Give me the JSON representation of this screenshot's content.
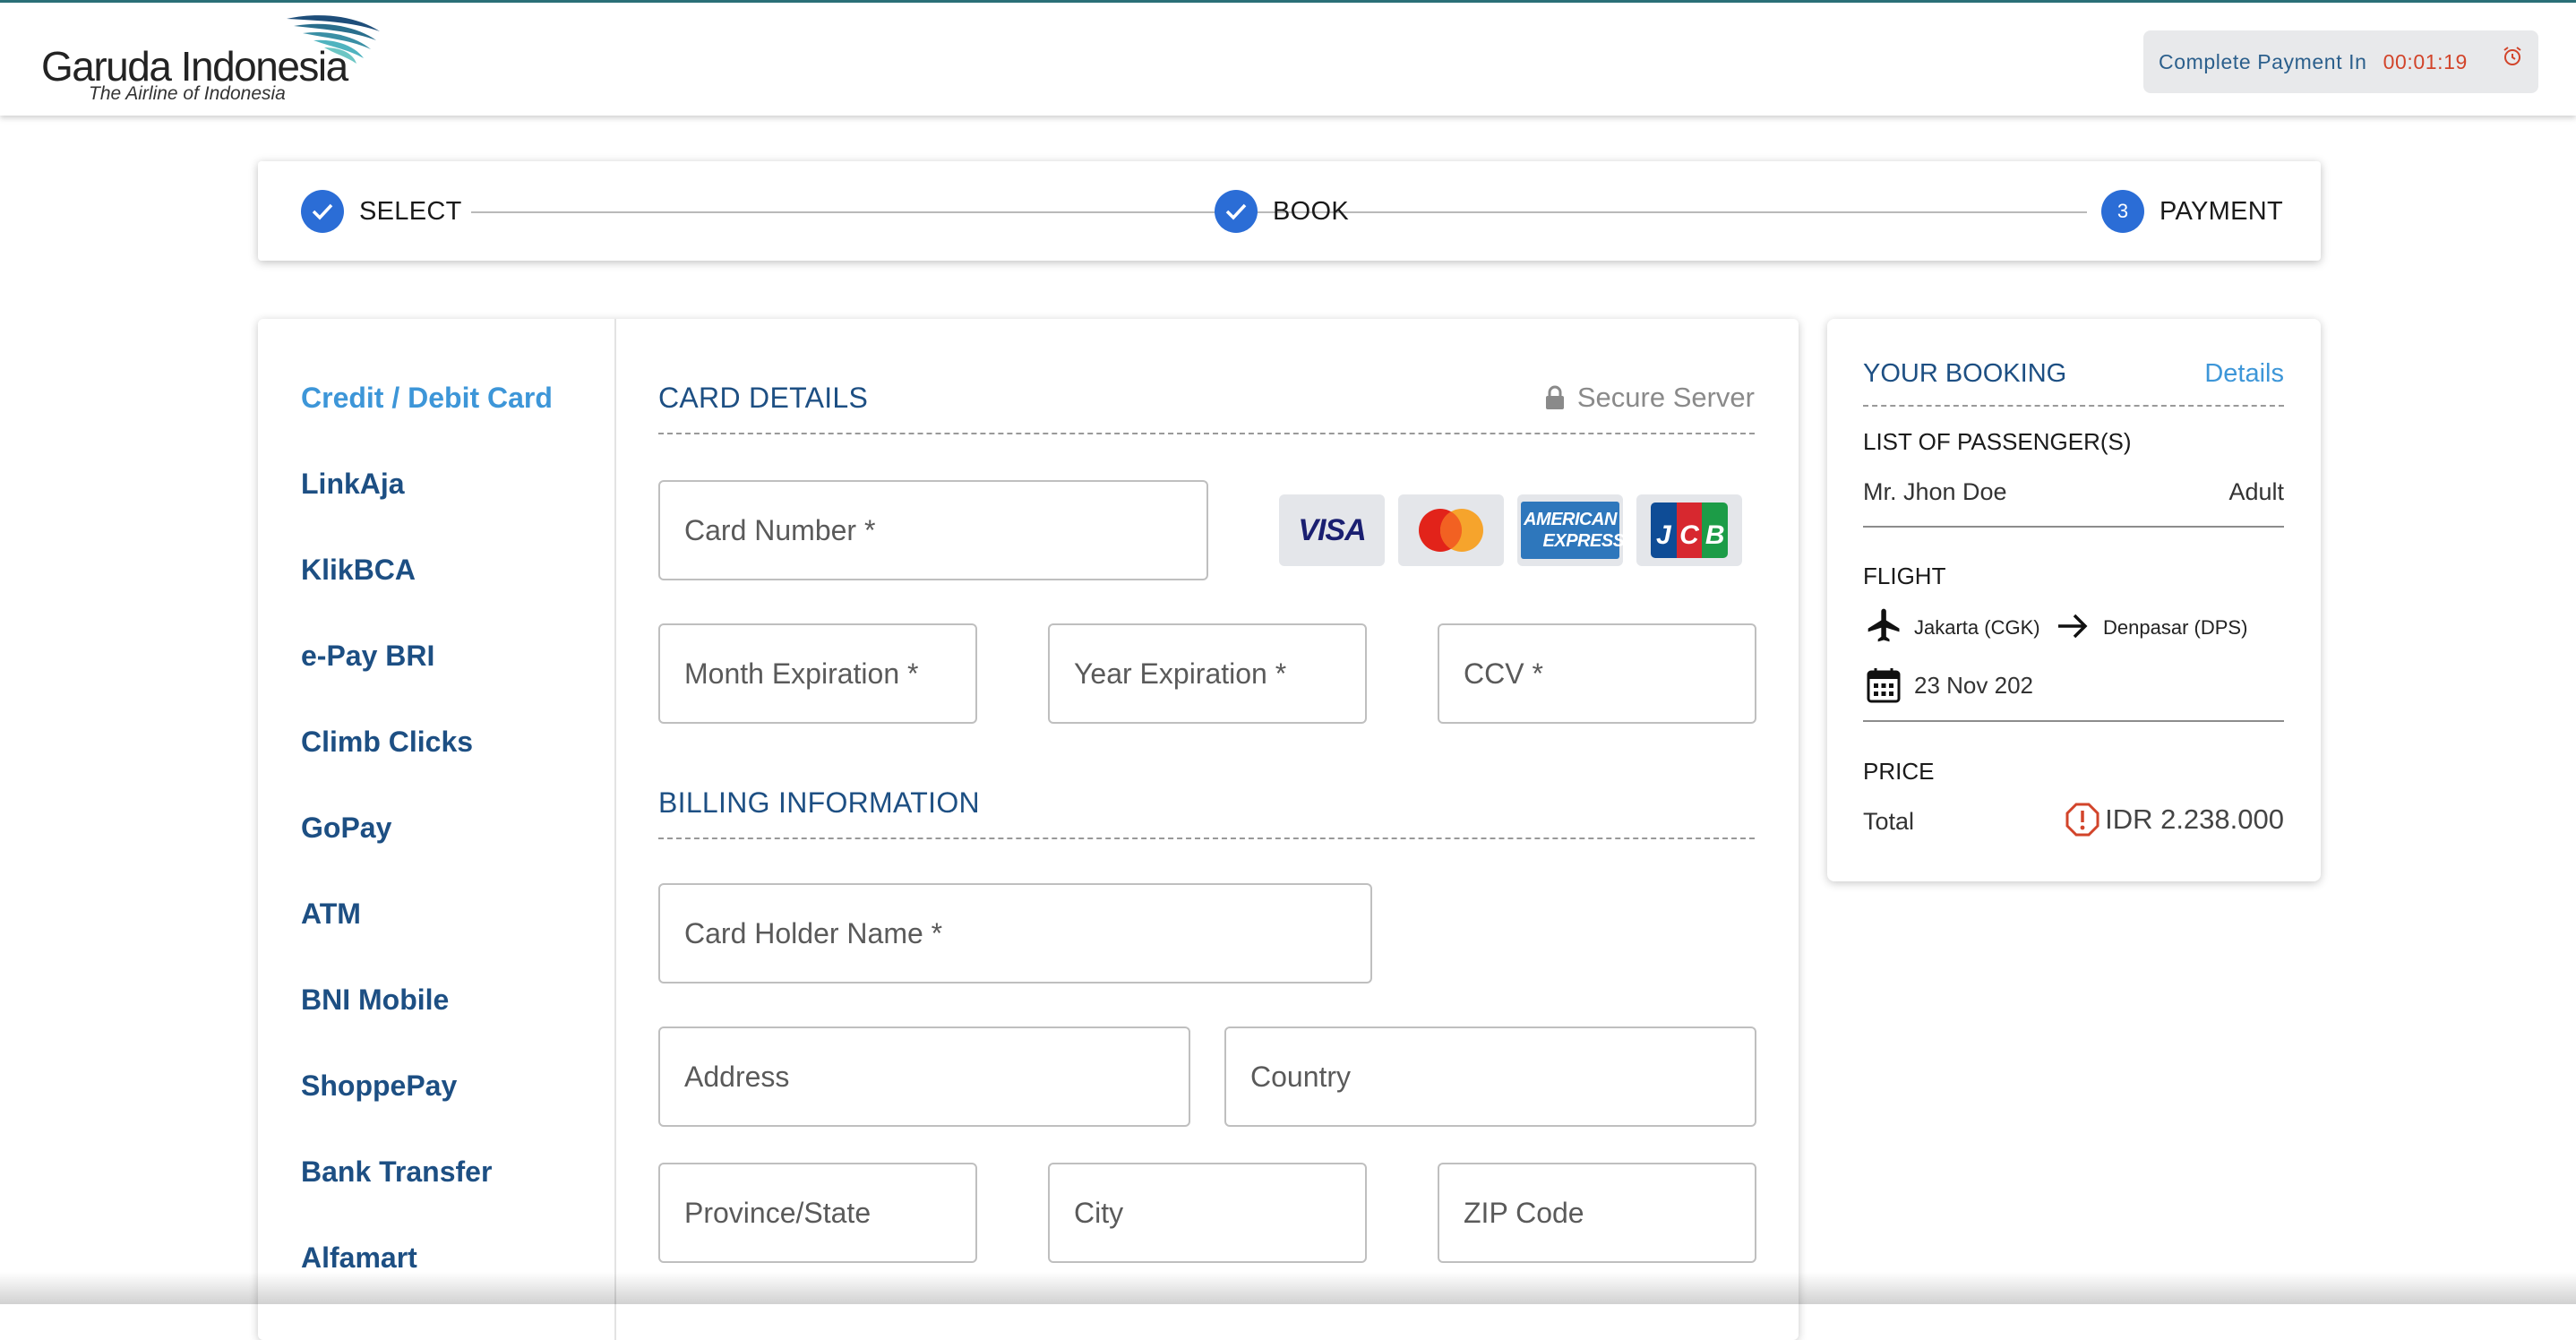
{
  "header": {
    "brand": "Garuda Indonesia",
    "tagline": "The Airline of Indonesia",
    "timer_label": "Complete Payment In",
    "timer_value": "00:01:19",
    "timer_icon": "alarm-clock-icon"
  },
  "stepper": {
    "steps": [
      {
        "label": "SELECT",
        "state": "done",
        "marker": "check-icon"
      },
      {
        "label": "BOOK",
        "state": "done",
        "marker": "check-icon"
      },
      {
        "label": "PAYMENT",
        "state": "current",
        "number": "3"
      }
    ]
  },
  "payment_methods": [
    {
      "label": "Credit / Debit Card",
      "active": true
    },
    {
      "label": "LinkAja"
    },
    {
      "label": "KlikBCA"
    },
    {
      "label": "e-Pay BRI"
    },
    {
      "label": "Climb Clicks"
    },
    {
      "label": "GoPay"
    },
    {
      "label": "ATM"
    },
    {
      "label": "BNI Mobile"
    },
    {
      "label": "ShoppePay"
    },
    {
      "label": "Bank Transfer"
    },
    {
      "label": "Alfamart"
    }
  ],
  "card_details": {
    "title": "CARD DETAILS",
    "secure_label": "Secure Server",
    "secure_icon": "lock-icon",
    "card_number_placeholder": "Card Number *",
    "month_placeholder": "Month Expiration *",
    "year_placeholder": "Year Expiration *",
    "ccv_placeholder": "CCV *",
    "card_logos": {
      "visa": "VISA",
      "mastercard": "mastercard-logo",
      "amex_line1": "AMERICAN",
      "amex_line2": "EXPRESS",
      "jcb": [
        "J",
        "C",
        "B"
      ]
    }
  },
  "billing": {
    "title": "BILLING INFORMATION",
    "holder_placeholder": "Card Holder Name *",
    "address_placeholder": "Address",
    "country_placeholder": "Country",
    "province_placeholder": "Province/State",
    "city_placeholder": "City",
    "zip_placeholder": "ZIP Code"
  },
  "booking": {
    "title": "YOUR BOOKING",
    "details_link": "Details",
    "passengers_heading": "LIST OF PASSENGER(S)",
    "passenger_name": "Mr. Jhon Doe",
    "passenger_type": "Adult",
    "flight_heading": "FLIGHT",
    "origin": "Jakarta (CGK)",
    "destination": "Denpasar (DPS)",
    "date": "23 Nov 202",
    "price_heading": "PRICE",
    "total_label": "Total",
    "total_value": "IDR 2.238.000"
  },
  "colors": {
    "brand_blue": "#1d4f83",
    "active_blue": "#3d96d8",
    "step_blue": "#2b6dd6",
    "timer_red": "#d2442a"
  }
}
